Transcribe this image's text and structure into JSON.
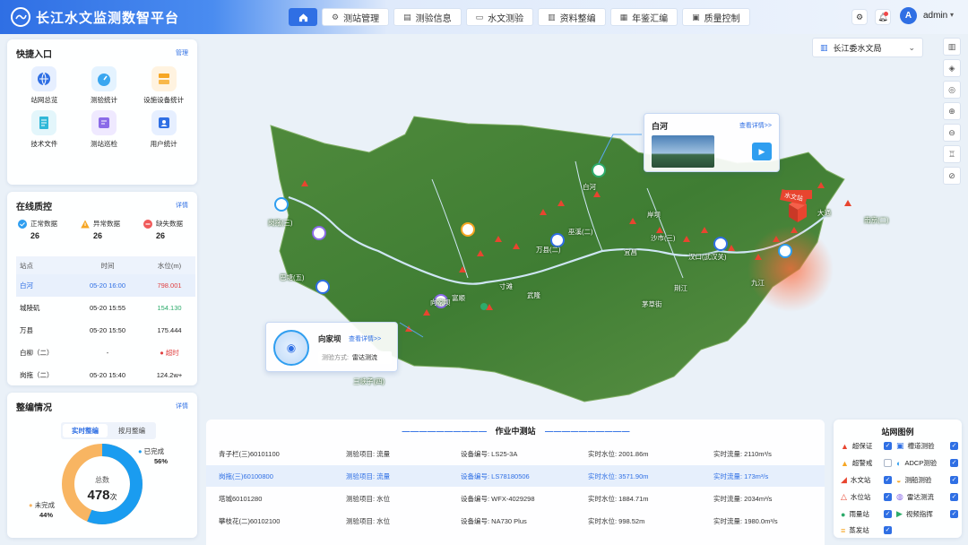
{
  "app": {
    "title": "长江水文监测数智平台"
  },
  "nav": {
    "home_icon": "home-icon",
    "items": [
      {
        "label": "测站管理",
        "icon": "gear-icon"
      },
      {
        "label": "测验信息",
        "icon": "file-icon"
      },
      {
        "label": "水文测验",
        "icon": "folder-icon"
      },
      {
        "label": "资料整编",
        "icon": "chart-icon"
      },
      {
        "label": "年鉴汇编",
        "icon": "book-icon"
      },
      {
        "label": "质量控制",
        "icon": "doc-icon"
      }
    ]
  },
  "user": {
    "avatar_letter": "A",
    "name": "admin"
  },
  "quick": {
    "title": "快捷入口",
    "link": "管理",
    "items": [
      "站网总览",
      "测验统计",
      "设施设备统计",
      "技术文件",
      "测站巡检",
      "用户统计"
    ]
  },
  "quality": {
    "title": "在线质控",
    "link": "详情",
    "stats": [
      {
        "label": "正常数据",
        "value": "26"
      },
      {
        "label": "异常数据",
        "value": "26"
      },
      {
        "label": "缺失数据",
        "value": "26"
      }
    ],
    "headers": [
      "站点",
      "时间",
      "水位(m)"
    ],
    "rows": [
      {
        "station": "白河",
        "time": "05-20 16:00",
        "level": "798.001"
      },
      {
        "station": "城陵矶",
        "time": "05-20 15:55",
        "level": "154.130"
      },
      {
        "station": "万县",
        "time": "05-20 15:50",
        "level": "175.444"
      },
      {
        "station": "白柳（二）",
        "time": "-",
        "level": "超时"
      },
      {
        "station": "岗拖（二）",
        "time": "05-20 15:40",
        "level": "124.2w+"
      }
    ]
  },
  "compile": {
    "title": "整编情况",
    "link": "详情",
    "tabs": [
      "实时整编",
      "按月整编"
    ],
    "center_label": "总数",
    "total": "478",
    "unit": "次",
    "done_label": "已完成",
    "done_pct": "56%",
    "undone_label": "未完成",
    "undone_pct": "44%",
    "done_fraction": 0.56
  },
  "region": {
    "label": "长江委水文局"
  },
  "map": {
    "labels": [
      "岗拖(三)",
      "巴塘(五)",
      "向家坝",
      "富顺",
      "寸滩",
      "武隆",
      "万县(二)",
      "巫溪(二)",
      "宜昌",
      "沙市(三)",
      "汉口(武汉关)",
      "九江",
      "大通",
      "南京(二)",
      "茅草街",
      "三峡子(四)",
      "白河",
      "荆江",
      "岸坝"
    ],
    "callout_baihe": {
      "name": "白河",
      "link": "查看详情>>"
    },
    "callout_xiangjiaba": {
      "name": "向家坝",
      "link": "查看详情>>",
      "method_label": "测验方式:",
      "method_value": "雷达测流"
    },
    "marker_flag": "水文站"
  },
  "working": {
    "title": "作业中测站",
    "rows": [
      {
        "station": "青子栏(三)60101100",
        "item": "测验项目: 流量",
        "device": "设备编号: LS25-3A",
        "level": "实时水位: 2001.86m",
        "flow": "实时流量: 2110m³/s"
      },
      {
        "station": "岗拖(三)60100800",
        "item": "测验项目: 流量",
        "device": "设备编号: LS78180506",
        "level": "实时水位: 3571.90m",
        "flow": "实时流量: 173m³/s"
      },
      {
        "station": "塔城60101280",
        "item": "测验项目: 水位",
        "device": "设备编号: WFX-4029298",
        "level": "实时水位: 1884.71m",
        "flow": "实时流量: 2034m³/s"
      },
      {
        "station": "攀枝花(二)60102100",
        "item": "测验项目: 水位",
        "device": "设备编号: NA730 Plus",
        "level": "实时水位: 998.52m",
        "flow": "实时流量: 1980.0m³/s"
      }
    ]
  },
  "legend": {
    "title": "站网图例",
    "items": [
      {
        "label": "超保证",
        "checked": true
      },
      {
        "label": "槽道测验",
        "checked": true
      },
      {
        "label": "超警戒",
        "checked": false
      },
      {
        "label": "ADCP测验",
        "checked": true
      },
      {
        "label": "水文站",
        "checked": true
      },
      {
        "label": "测船测验",
        "checked": true
      },
      {
        "label": "水位站",
        "checked": true
      },
      {
        "label": "雷达测流",
        "checked": true
      },
      {
        "label": "雨量站",
        "checked": true
      },
      {
        "label": "视频指挥",
        "checked": true
      },
      {
        "label": "蒸发站",
        "checked": true
      }
    ]
  },
  "colors": {
    "accent": "#2f6fe4",
    "danger": "#e04040",
    "ok": "#2dab6b",
    "orange": "#f6a623",
    "done": "#1a9cf0",
    "undone": "#f8b562"
  }
}
